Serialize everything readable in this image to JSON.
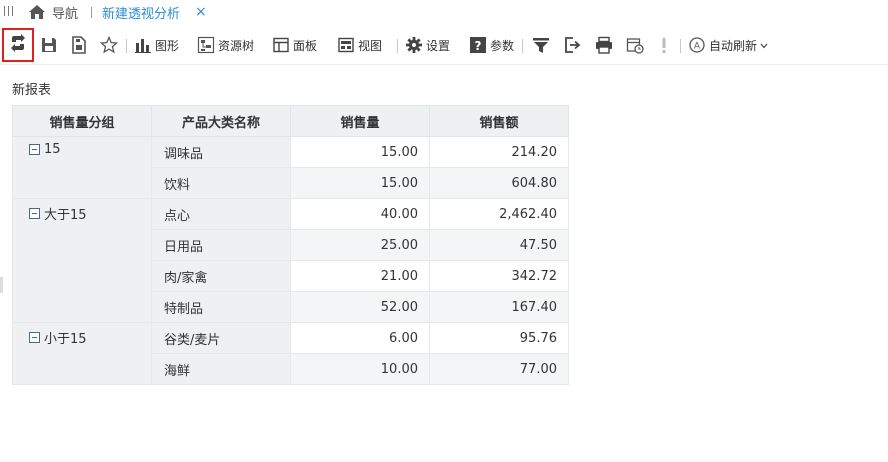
{
  "tabs": {
    "home_label": "导航",
    "active_label": "新建透视分析",
    "close_glyph": "×"
  },
  "toolbar": {
    "chart_label": "图形",
    "resource_tree_label": "资源树",
    "panel_label": "面板",
    "view_label": "视图",
    "settings_label": "设置",
    "params_label": "参数",
    "auto_refresh_label": "自动刷新",
    "icons": [
      "refresh-icon",
      "save-icon",
      "save-as-icon",
      "star-icon",
      "bar-chart-icon",
      "resource-tree-icon",
      "panel-icon",
      "view-icon",
      "gear-icon",
      "help-icon",
      "filter-icon",
      "export-icon",
      "print-icon",
      "schedule-icon",
      "warning-icon",
      "auto-refresh-icon",
      "chevron-down-icon"
    ]
  },
  "report": {
    "title": "新报表",
    "headers": [
      "销售量分组",
      "产品大类名称",
      "销售量",
      "销售额"
    ],
    "groups": [
      {
        "name": "15",
        "rows": [
          {
            "category": "调味品",
            "qty": "15.00",
            "amount": "214.20"
          },
          {
            "category": "饮料",
            "qty": "15.00",
            "amount": "604.80"
          }
        ]
      },
      {
        "name": "大于15",
        "rows": [
          {
            "category": "点心",
            "qty": "40.00",
            "amount": "2,462.40"
          },
          {
            "category": "日用品",
            "qty": "25.00",
            "amount": "47.50"
          },
          {
            "category": "肉/家禽",
            "qty": "21.00",
            "amount": "342.72"
          },
          {
            "category": "特制品",
            "qty": "52.00",
            "amount": "167.40"
          }
        ]
      },
      {
        "name": "小于15",
        "rows": [
          {
            "category": "谷类/麦片",
            "qty": "6.00",
            "amount": "95.76"
          },
          {
            "category": "海鲜",
            "qty": "10.00",
            "amount": "77.00"
          }
        ]
      }
    ]
  },
  "colors": {
    "accent": "#2d8bd9",
    "highlight_border": "#e02020",
    "header_bg": "#eef0f2"
  }
}
